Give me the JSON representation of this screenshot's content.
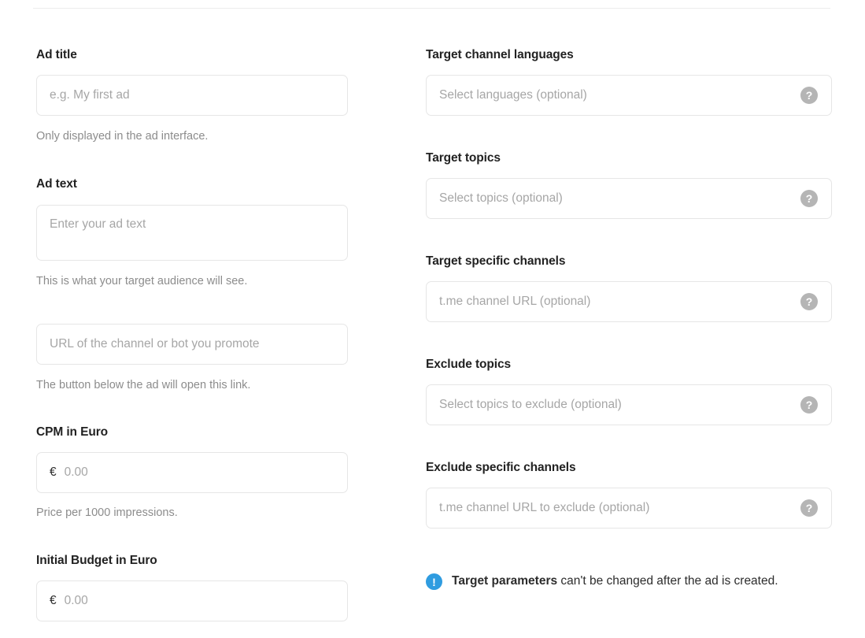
{
  "left_column": {
    "fields": [
      {
        "label": "Ad title",
        "placeholder": "e.g. My first ad",
        "helper": "Only displayed in the ad interface.",
        "value": ""
      },
      {
        "label": "Ad text",
        "placeholder": "Enter your ad text",
        "helper": "This is what your target audience will see.",
        "value": ""
      },
      {
        "label": "",
        "placeholder": "URL of the channel or bot you promote",
        "helper": "The button below the ad will open this link.",
        "value": ""
      },
      {
        "label": "CPM in Euro",
        "prefix": "€",
        "placeholder": "0.00",
        "helper": "Price per 1000 impressions.",
        "value": ""
      },
      {
        "label": "Initial Budget in Euro",
        "prefix": "€",
        "placeholder": "0.00",
        "helper": "",
        "value": ""
      }
    ]
  },
  "right_column": {
    "fields": [
      {
        "label": "Target channel languages",
        "placeholder": "Select languages (optional)",
        "help_icon": "help-circle-icon",
        "help_glyph": "?",
        "value": ""
      },
      {
        "label": "Target topics",
        "placeholder": "Select topics (optional)",
        "help_icon": "help-circle-icon",
        "help_glyph": "?",
        "value": ""
      },
      {
        "label": "Target specific channels",
        "placeholder": "t.me channel URL (optional)",
        "help_icon": "help-circle-icon",
        "help_glyph": "?",
        "value": ""
      },
      {
        "label": "Exclude topics",
        "placeholder": "Select topics to exclude (optional)",
        "help_icon": "help-circle-icon",
        "help_glyph": "?",
        "value": ""
      },
      {
        "label": "Exclude specific channels",
        "placeholder": "t.me channel URL to exclude (optional)",
        "help_icon": "help-circle-icon",
        "help_glyph": "?",
        "value": ""
      }
    ],
    "notice": {
      "icon": "info-circle-icon",
      "icon_glyph": "!",
      "bold_text": "Target parameters",
      "rest_text": " can't be changed after the ad is created."
    }
  },
  "colors": {
    "label": "#222222",
    "placeholder": "#a6a6a6",
    "helper": "#8c8c8c",
    "border": "#e6e6e6",
    "help_icon_bg": "#b5b5b5",
    "info_icon_bg": "#2f9ce0",
    "divider": "#ececec",
    "background": "#ffffff"
  }
}
